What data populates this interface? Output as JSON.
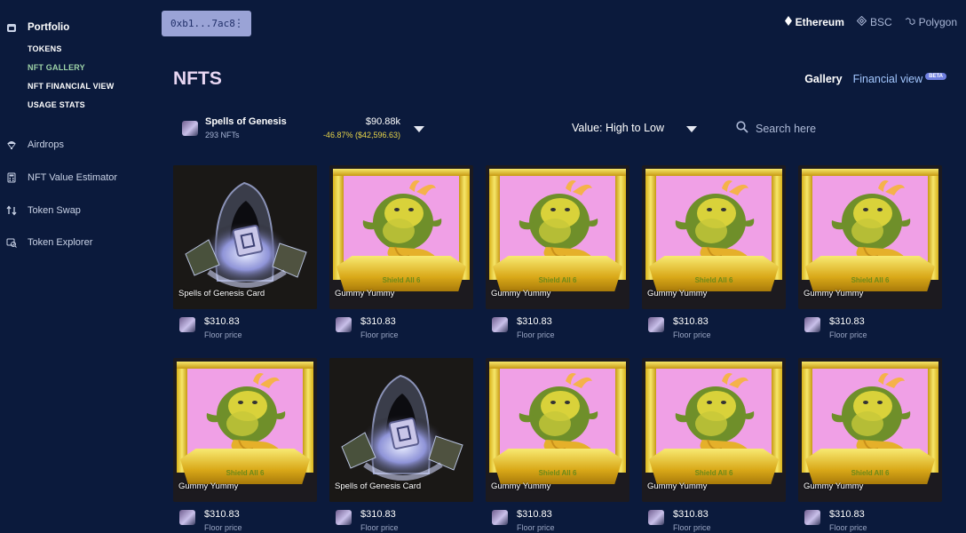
{
  "sidebar": {
    "items": [
      {
        "label": "Portfolio",
        "icon": "wallet-icon"
      },
      {
        "label": "Airdrops",
        "icon": "parachute-icon"
      },
      {
        "label": "NFT Value Estimator",
        "icon": "calculator-icon"
      },
      {
        "label": "Token Swap",
        "icon": "swap-icon"
      },
      {
        "label": "Token Explorer",
        "icon": "explorer-icon"
      }
    ],
    "portfolio_sub": [
      "TOKENS",
      "NFT GALLERY",
      "NFT FINANCIAL VIEW",
      "USAGE STATS"
    ],
    "active_sub": "NFT GALLERY"
  },
  "topbar": {
    "wallet": "0xb1...7ac8",
    "menu_glyph": "⋮",
    "chains": [
      {
        "label": "Ethereum",
        "icon": "ethereum-icon",
        "active": true
      },
      {
        "label": "BSC",
        "icon": "bsc-icon",
        "active": false
      },
      {
        "label": "Polygon",
        "icon": "polygon-icon",
        "active": false
      }
    ]
  },
  "page": {
    "title": "NFTS",
    "tabs": [
      {
        "label": "Gallery",
        "active": true
      },
      {
        "label": "Financial view",
        "active": false,
        "badge": "BETA"
      }
    ]
  },
  "collection": {
    "name": "Spells of Genesis",
    "count": "293 NFTs",
    "value": "$90.88k",
    "change": "-46.87% ($42,596.63)"
  },
  "sort": {
    "label": "Value: High to Low"
  },
  "search": {
    "placeholder": "Search here"
  },
  "nfts": [
    {
      "name": "Spells of Genesis Card",
      "art": "spells",
      "price": "$310.83",
      "floor_label": "Floor price"
    },
    {
      "name": "Gummy Yummy",
      "art": "gummy",
      "price": "$310.83",
      "floor_label": "Floor price"
    },
    {
      "name": "Gummy Yummy",
      "art": "gummy",
      "price": "$310.83",
      "floor_label": "Floor price"
    },
    {
      "name": "Gummy Yummy",
      "art": "gummy",
      "price": "$310.83",
      "floor_label": "Floor price"
    },
    {
      "name": "Gummy Yummy",
      "art": "gummy",
      "price": "$310.83",
      "floor_label": "Floor price"
    },
    {
      "name": "Gummy Yummy",
      "art": "gummy",
      "price": "$310.83",
      "floor_label": "Floor price"
    },
    {
      "name": "Spells of Genesis Card",
      "art": "spells",
      "price": "$310.83",
      "floor_label": "Floor price"
    },
    {
      "name": "Gummy Yummy",
      "art": "gummy",
      "price": "$310.83",
      "floor_label": "Floor price"
    },
    {
      "name": "Gummy Yummy",
      "art": "gummy",
      "price": "$310.83",
      "floor_label": "Floor price"
    },
    {
      "name": "Gummy Yummy",
      "art": "gummy",
      "price": "$310.83",
      "floor_label": "Floor price"
    }
  ],
  "banner_text": "Shield All 6",
  "colors": {
    "background": "#0b1a3c",
    "wallet_button": "#9aa3d6",
    "active_sub": "#9ed3a8",
    "change": "#e8d54a",
    "tab_link": "#a3c7ff"
  }
}
